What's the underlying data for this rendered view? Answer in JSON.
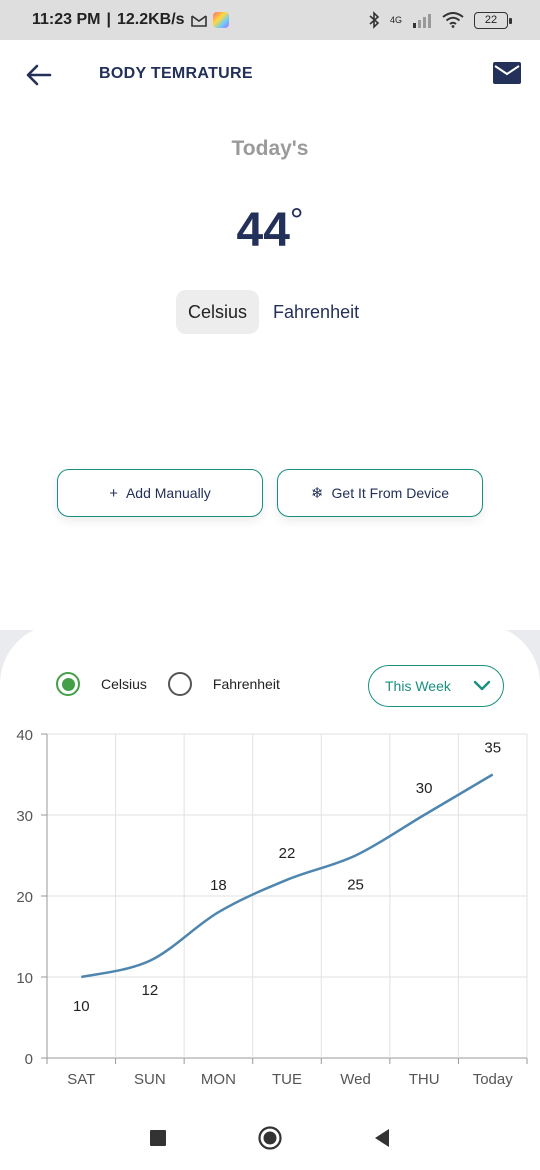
{
  "status_bar": {
    "time": "11:23 PM",
    "separator": "|",
    "speed": "12.2KB/s",
    "network": "4G",
    "battery": "22"
  },
  "header": {
    "title": "BODY TEMRATURE"
  },
  "today": {
    "label": "Today's",
    "value": "44",
    "degree": "°"
  },
  "unit_toggle": {
    "celsius": "Celsius",
    "fahrenheit": "Fahrenheit",
    "selected": "Celsius"
  },
  "actions": {
    "add_icon": "+",
    "add_label": "Add Manually",
    "device_icon": "❄",
    "device_label": "Get It From Device"
  },
  "chart_controls": {
    "radio_celsius": "Celsius",
    "radio_fahrenheit": "Fahrenheit",
    "selected": "Celsius",
    "period": "This Week"
  },
  "colors": {
    "primary": "#23305a",
    "accent": "#1a8f7f",
    "radio_checked": "#43a047",
    "line": "#4e86b0"
  },
  "chart_data": {
    "type": "line",
    "categories": [
      "SAT",
      "SUN",
      "MON",
      "TUE",
      "Wed",
      "THU",
      "Today"
    ],
    "values": [
      10,
      12,
      18,
      22,
      25,
      30,
      35
    ],
    "ylim": [
      0,
      40
    ],
    "yticks": [
      0,
      10,
      20,
      30,
      40
    ],
    "grid": true,
    "legend": "none"
  }
}
